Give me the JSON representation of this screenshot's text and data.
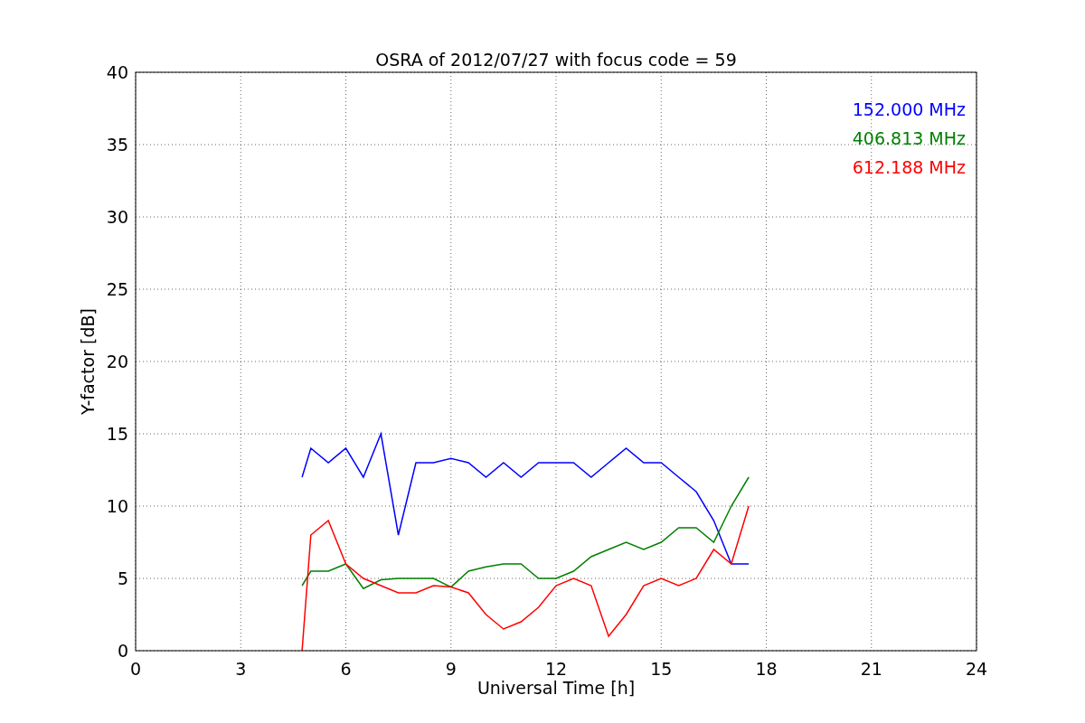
{
  "chart_data": {
    "type": "line",
    "title": "OSRA of 2012/07/27 with focus code = 59",
    "xlabel": "Universal Time [h]",
    "ylabel": "Y-factor [dB]",
    "x": [
      4.75,
      5,
      5.5,
      6,
      6.5,
      7,
      7.5,
      8,
      8.5,
      9,
      9.5,
      10,
      10.5,
      11,
      11.5,
      12,
      12.5,
      13,
      13.5,
      14,
      14.5,
      15,
      15.5,
      16,
      16.5,
      17,
      17.5
    ],
    "series": [
      {
        "name": "152.000 MHz",
        "color": "#0000ff",
        "values": [
          12,
          14,
          13,
          14,
          12,
          15,
          8,
          13,
          13,
          13.3,
          13,
          12,
          13,
          12,
          13,
          13,
          13,
          12,
          13,
          14,
          13,
          13,
          12,
          11,
          9,
          6,
          6
        ]
      },
      {
        "name": "406.813 MHz",
        "color": "#008000",
        "values": [
          4.5,
          5.5,
          5.5,
          6,
          4.3,
          4.9,
          5,
          5,
          5,
          4.4,
          5.5,
          5.8,
          6,
          6,
          5,
          5,
          5.5,
          6.5,
          7,
          7.5,
          7,
          7.5,
          8.5,
          8.5,
          7.5,
          10,
          12
        ]
      },
      {
        "name": "612.188 MHz",
        "color": "#ff0000",
        "values": [
          0,
          8,
          9,
          6,
          5,
          4.5,
          4,
          4,
          4.5,
          4.4,
          4,
          2.5,
          1.5,
          2,
          3,
          4.5,
          5,
          4.5,
          1,
          2.5,
          4.5,
          5,
          4.5,
          5,
          7,
          6,
          10
        ]
      }
    ],
    "xlim": [
      0,
      24
    ],
    "ylim": [
      0,
      40
    ],
    "xticks": [
      0,
      3,
      6,
      9,
      12,
      15,
      18,
      21,
      24
    ],
    "yticks": [
      0,
      5,
      10,
      15,
      20,
      25,
      30,
      35,
      40
    ],
    "grid": true
  }
}
